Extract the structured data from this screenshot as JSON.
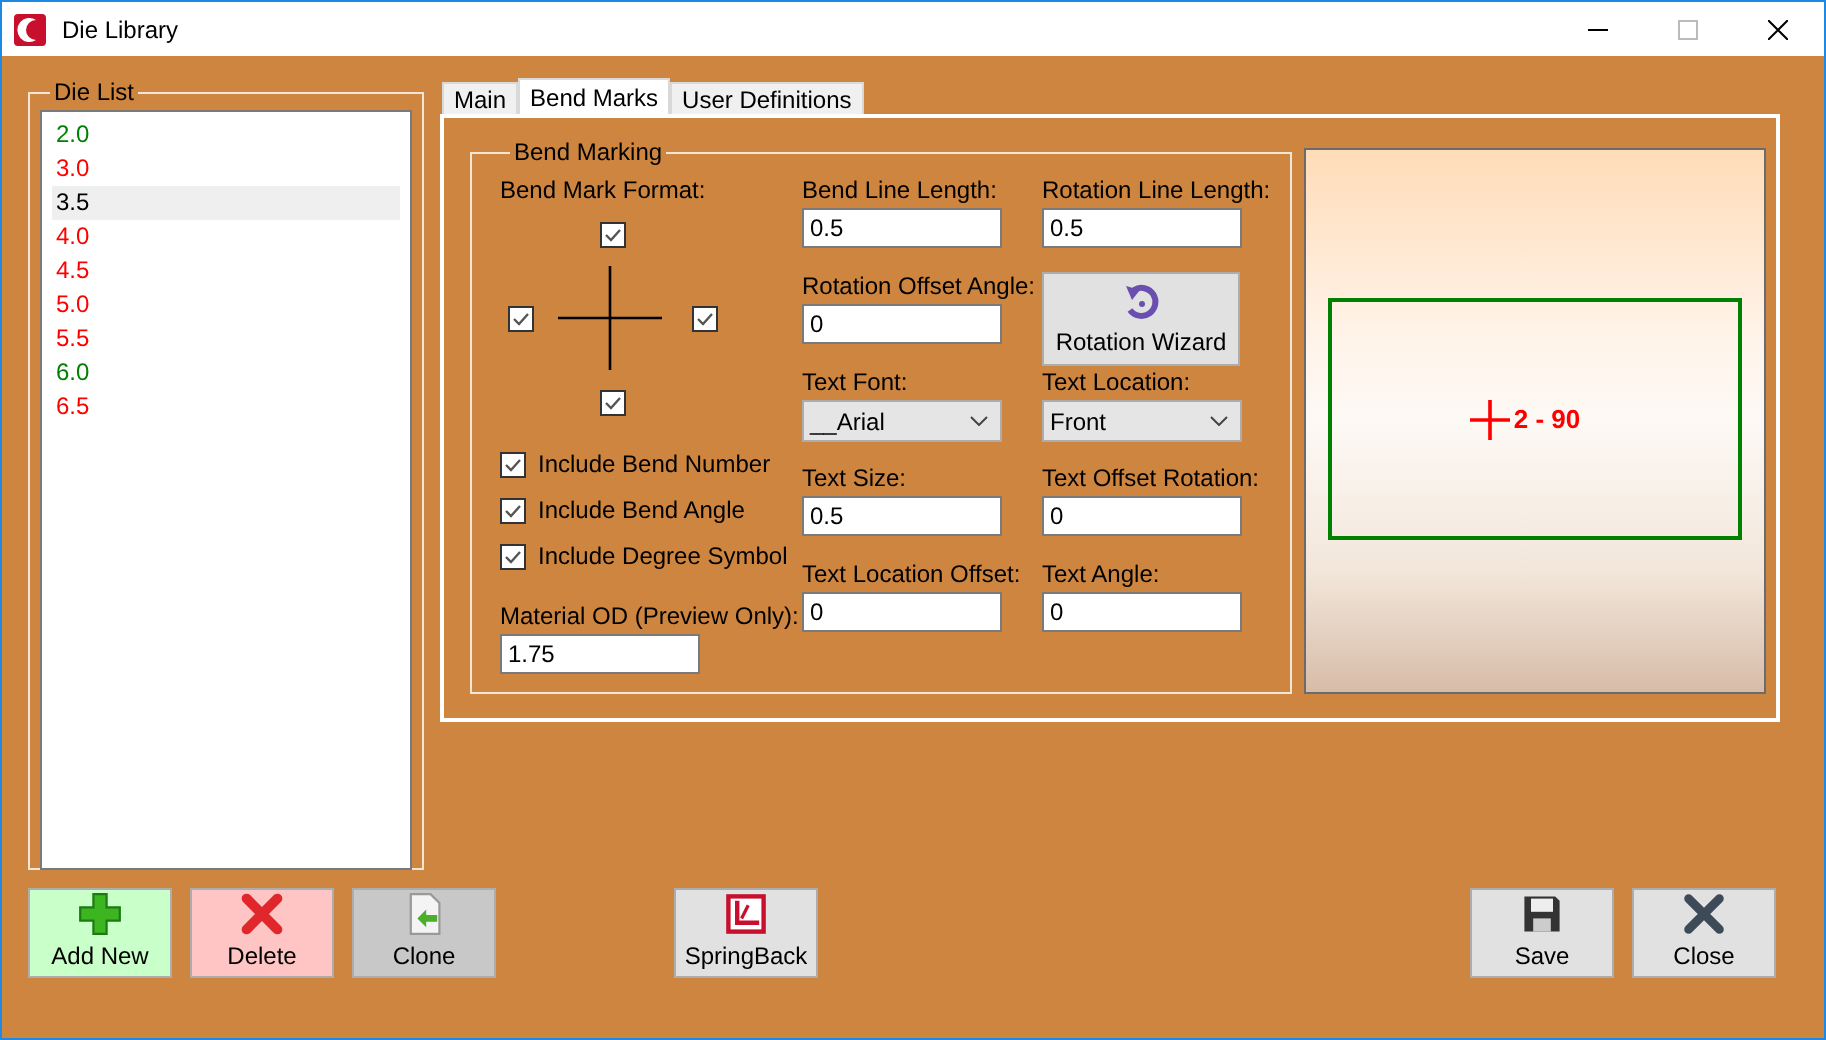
{
  "window": {
    "title": "Die Library"
  },
  "die_list": {
    "title": "Die List",
    "items": [
      {
        "label": "2.0",
        "color": "#008000",
        "selected": false
      },
      {
        "label": "3.0",
        "color": "#ff0000",
        "selected": false
      },
      {
        "label": "3.5",
        "color": "#000000",
        "selected": true
      },
      {
        "label": "4.0",
        "color": "#ff0000",
        "selected": false
      },
      {
        "label": "4.5",
        "color": "#ff0000",
        "selected": false
      },
      {
        "label": "5.0",
        "color": "#ff0000",
        "selected": false
      },
      {
        "label": "5.5",
        "color": "#ff0000",
        "selected": false
      },
      {
        "label": "6.0",
        "color": "#008000",
        "selected": false
      },
      {
        "label": "6.5",
        "color": "#ff0000",
        "selected": false
      }
    ]
  },
  "tabs": [
    {
      "label": "Main",
      "selected": false
    },
    {
      "label": "Bend Marks",
      "selected": true
    },
    {
      "label": "User Definitions",
      "selected": false
    }
  ],
  "bend_marking": {
    "title": "Bend Marking",
    "format_label": "Bend Mark Format:",
    "format_checks": [
      {
        "checked": true
      },
      {
        "checked": true
      },
      {
        "checked": true
      },
      {
        "checked": true
      }
    ],
    "options": [
      {
        "label": "Include Bend Number",
        "checked": true
      },
      {
        "label": "Include Bend Angle",
        "checked": true
      },
      {
        "label": "Include Degree Symbol",
        "checked": true
      }
    ],
    "material_od": {
      "label": "Material OD (Preview Only):",
      "value": "1.75"
    },
    "fields": [
      {
        "kind": "text",
        "label": "Bend Line Length:",
        "value": "0.5"
      },
      {
        "kind": "text",
        "label": "Rotation Line Length:",
        "value": "0.5"
      },
      {
        "kind": "text",
        "label": "Rotation Offset Angle:",
        "value": "0"
      },
      {
        "kind": "button",
        "label": "Rotation Wizard"
      },
      {
        "kind": "select",
        "label": "Text Font:",
        "value": "__Arial"
      },
      {
        "kind": "select",
        "label": "Text Location:",
        "value": "Front"
      },
      {
        "kind": "text",
        "label": "Text Size:",
        "value": "0.5"
      },
      {
        "kind": "text",
        "label": "Text Offset Rotation:",
        "value": "0"
      },
      {
        "kind": "text",
        "label": "Text Location Offset:",
        "value": "0"
      },
      {
        "kind": "text",
        "label": "Text Angle:",
        "value": "0"
      }
    ]
  },
  "preview": {
    "mark_text": "2 - 90"
  },
  "button_groups": [
    [
      {
        "kind": "add",
        "label": "Add New"
      },
      {
        "kind": "delete",
        "label": "Delete"
      },
      {
        "kind": "clone",
        "label": "Clone"
      }
    ],
    [
      {
        "kind": "springback",
        "label": "SpringBack"
      }
    ],
    [
      {
        "kind": "save",
        "label": "Save"
      },
      {
        "kind": "close",
        "label": "Close"
      }
    ]
  ]
}
